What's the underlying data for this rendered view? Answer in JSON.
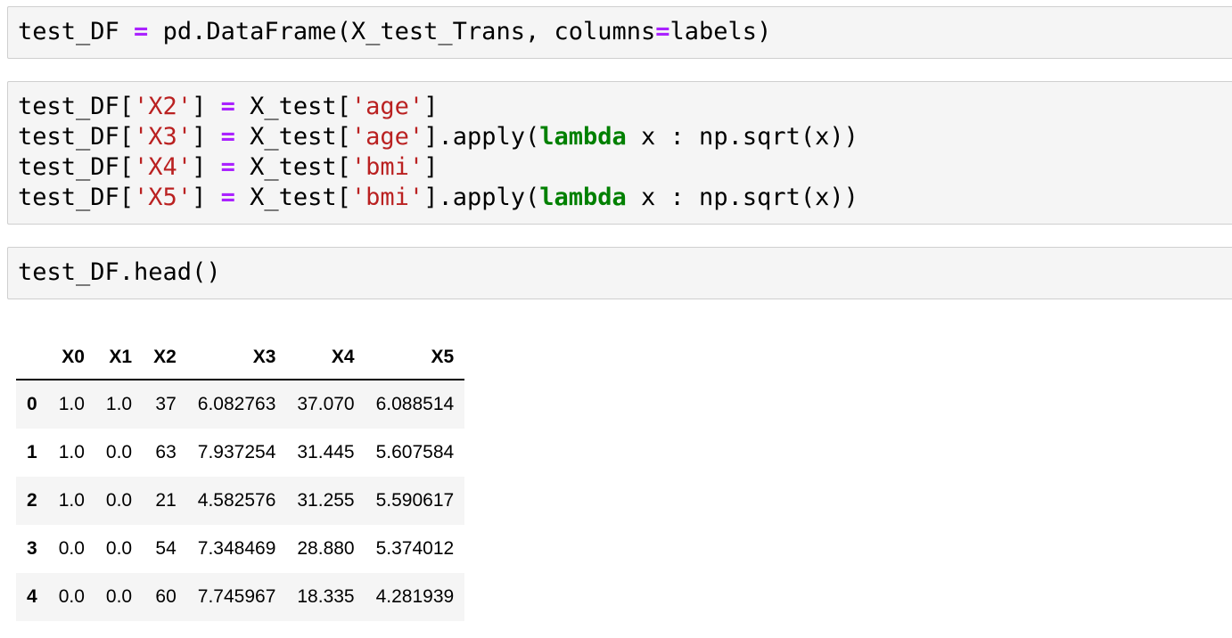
{
  "cells": [
    {
      "lines": [
        [
          {
            "t": "test_DF "
          },
          {
            "t": "=",
            "c": "op"
          },
          {
            "t": " pd.DataFrame(X_test_Trans, columns"
          },
          {
            "t": "=",
            "c": "op"
          },
          {
            "t": "labels)"
          }
        ]
      ]
    },
    {
      "lines": [
        [
          {
            "t": "test_DF["
          },
          {
            "t": "'X2'",
            "c": "str"
          },
          {
            "t": "] "
          },
          {
            "t": "=",
            "c": "op"
          },
          {
            "t": " X_test["
          },
          {
            "t": "'age'",
            "c": "str"
          },
          {
            "t": "]"
          }
        ],
        [
          {
            "t": "test_DF["
          },
          {
            "t": "'X3'",
            "c": "str"
          },
          {
            "t": "] "
          },
          {
            "t": "=",
            "c": "op"
          },
          {
            "t": " X_test["
          },
          {
            "t": "'age'",
            "c": "str"
          },
          {
            "t": "].apply("
          },
          {
            "t": "lambda",
            "c": "kw"
          },
          {
            "t": " x : np.sqrt(x))"
          }
        ],
        [
          {
            "t": "test_DF["
          },
          {
            "t": "'X4'",
            "c": "str"
          },
          {
            "t": "] "
          },
          {
            "t": "=",
            "c": "op"
          },
          {
            "t": " X_test["
          },
          {
            "t": "'bmi'",
            "c": "str"
          },
          {
            "t": "]"
          }
        ],
        [
          {
            "t": "test_DF["
          },
          {
            "t": "'X5'",
            "c": "str"
          },
          {
            "t": "] "
          },
          {
            "t": "=",
            "c": "op"
          },
          {
            "t": " X_test["
          },
          {
            "t": "'bmi'",
            "c": "str"
          },
          {
            "t": "].apply("
          },
          {
            "t": "lambda",
            "c": "kw"
          },
          {
            "t": " x : np.sqrt(x))"
          }
        ]
      ]
    },
    {
      "lines": [
        [
          {
            "t": "test_DF.head()"
          }
        ]
      ]
    }
  ],
  "table": {
    "corner": "",
    "columns": [
      "X0",
      "X1",
      "X2",
      "X3",
      "X4",
      "X5"
    ],
    "rows": [
      {
        "index": "0",
        "values": [
          "1.0",
          "1.0",
          "37",
          "6.082763",
          "37.070",
          "6.088514"
        ]
      },
      {
        "index": "1",
        "values": [
          "1.0",
          "0.0",
          "63",
          "7.937254",
          "31.445",
          "5.607584"
        ]
      },
      {
        "index": "2",
        "values": [
          "1.0",
          "0.0",
          "21",
          "4.582576",
          "31.255",
          "5.590617"
        ]
      },
      {
        "index": "3",
        "values": [
          "0.0",
          "0.0",
          "54",
          "7.348469",
          "28.880",
          "5.374012"
        ]
      },
      {
        "index": "4",
        "values": [
          "0.0",
          "0.0",
          "60",
          "7.745967",
          "18.335",
          "4.281939"
        ]
      }
    ]
  }
}
